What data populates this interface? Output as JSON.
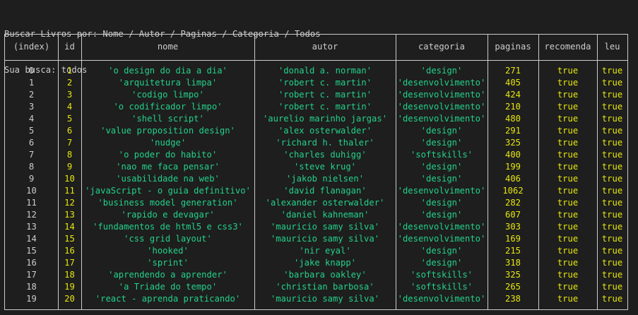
{
  "terminal": {
    "line1": "Buscar Livros por: Nome / Autor / Paginas / Categoria / Todos",
    "line2": "Sua busca: todos"
  },
  "table": {
    "columns": [
      "(index)",
      "id",
      "nome",
      "autor",
      "categoria",
      "paginas",
      "recomenda",
      "leu"
    ],
    "rows": [
      [
        "0",
        "1",
        "'o design do dia a dia'",
        "'donald a. norman'",
        "'design'",
        "271",
        "true",
        "true"
      ],
      [
        "1",
        "2",
        "'arquitetura limpa'",
        "'robert c. martin'",
        "'desenvolvimento'",
        "405",
        "true",
        "true"
      ],
      [
        "2",
        "3",
        "'codigo limpo'",
        "'robert c. martin'",
        "'desenvolvimento'",
        "424",
        "true",
        "true"
      ],
      [
        "3",
        "4",
        "'o codificador limpo'",
        "'robert c. martin'",
        "'desenvolvimento'",
        "210",
        "true",
        "true"
      ],
      [
        "4",
        "5",
        "'shell script'",
        "'aurelio marinho jargas'",
        "'desenvolvimento'",
        "480",
        "true",
        "true"
      ],
      [
        "5",
        "6",
        "'value proposition design'",
        "'alex osterwalder'",
        "'design'",
        "291",
        "true",
        "true"
      ],
      [
        "6",
        "7",
        "'nudge'",
        "'richard h. thaler'",
        "'design'",
        "325",
        "true",
        "true"
      ],
      [
        "7",
        "8",
        "'o poder do habito'",
        "'charles duhigg'",
        "'softskills'",
        "400",
        "true",
        "true"
      ],
      [
        "8",
        "9",
        "'nao me faca pensar'",
        "'steve krug'",
        "'design'",
        "199",
        "true",
        "true"
      ],
      [
        "9",
        "10",
        "'usabilidade na web'",
        "'jakob nielsen'",
        "'design'",
        "406",
        "true",
        "true"
      ],
      [
        "10",
        "11",
        "'javaScript - o guia definitivo'",
        "'david flanagan'",
        "'desenvolvimento'",
        "1062",
        "true",
        "true"
      ],
      [
        "11",
        "12",
        "'business model generation'",
        "'alexander osterwalder'",
        "'design'",
        "282",
        "true",
        "true"
      ],
      [
        "12",
        "13",
        "'rapido e devagar'",
        "'daniel kahneman'",
        "'design'",
        "607",
        "true",
        "true"
      ],
      [
        "13",
        "14",
        "'fundamentos de html5 e css3'",
        "'mauricio samy silva'",
        "'desenvolvimento'",
        "303",
        "true",
        "true"
      ],
      [
        "14",
        "15",
        "'css grid layout'",
        "'mauricio samy silva'",
        "'desenvolvimento'",
        "169",
        "true",
        "true"
      ],
      [
        "15",
        "16",
        "'hooked'",
        "'nir eyal'",
        "'design'",
        "215",
        "true",
        "true"
      ],
      [
        "16",
        "17",
        "'sprint'",
        "'jake knapp'",
        "'design'",
        "318",
        "true",
        "true"
      ],
      [
        "17",
        "18",
        "'aprendendo a aprender'",
        "'barbara oakley'",
        "'softskills'",
        "325",
        "true",
        "true"
      ],
      [
        "18",
        "19",
        "'a Triade do tempo'",
        "'christian barbosa'",
        "'softskills'",
        "265",
        "true",
        "true"
      ],
      [
        "19",
        "20",
        "'react - aprenda praticando'",
        "'mauricio samy silva'",
        "'desenvolvimento'",
        "238",
        "true",
        "true"
      ]
    ]
  },
  "colors": {
    "background": "#1e1e1e",
    "text": "#cccccc",
    "number_yellow": "#e5e510",
    "string_green": "#23d18b"
  }
}
